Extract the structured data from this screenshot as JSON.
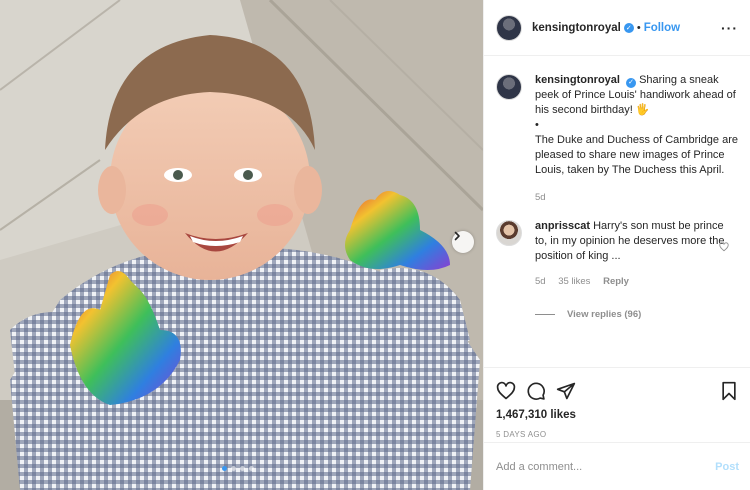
{
  "header": {
    "username": "kensingtonroyal",
    "separator": "•",
    "follow_label": "Follow",
    "more_label": "···"
  },
  "caption": {
    "username": "kensingtonroyal",
    "line1": "Sharing a sneak peek of Prince Louis' handiwork ahead of his second birthday! 🖐",
    "bullet": "•",
    "line2": "The Duke and Duchess of Cambridge are pleased to share new images of Prince Louis, taken by The Duchess this April.",
    "age": "5d"
  },
  "comment": {
    "username": "anprisscat",
    "text": "Harry's son must be prince to, in my opinion he deserves more the position of king ...",
    "age": "5d",
    "likes": "35 likes",
    "reply_label": "Reply",
    "view_replies": "View replies (96)"
  },
  "post": {
    "likes": "1,467,310 likes",
    "time": "5 DAYS AGO",
    "carousel_count": 4,
    "carousel_active": 0
  },
  "composer": {
    "placeholder": "Add a comment...",
    "post_label": "Post"
  },
  "icons": {
    "like": "heart-icon",
    "comment": "comment-icon",
    "share": "share-icon",
    "save": "bookmark-icon",
    "next": "chevron-right-icon",
    "verified": "verified-badge-icon"
  },
  "colors": {
    "accent": "#3897f0",
    "post_disabled": "#b2dffc",
    "muted": "#8e8e8e",
    "text": "#262626"
  }
}
